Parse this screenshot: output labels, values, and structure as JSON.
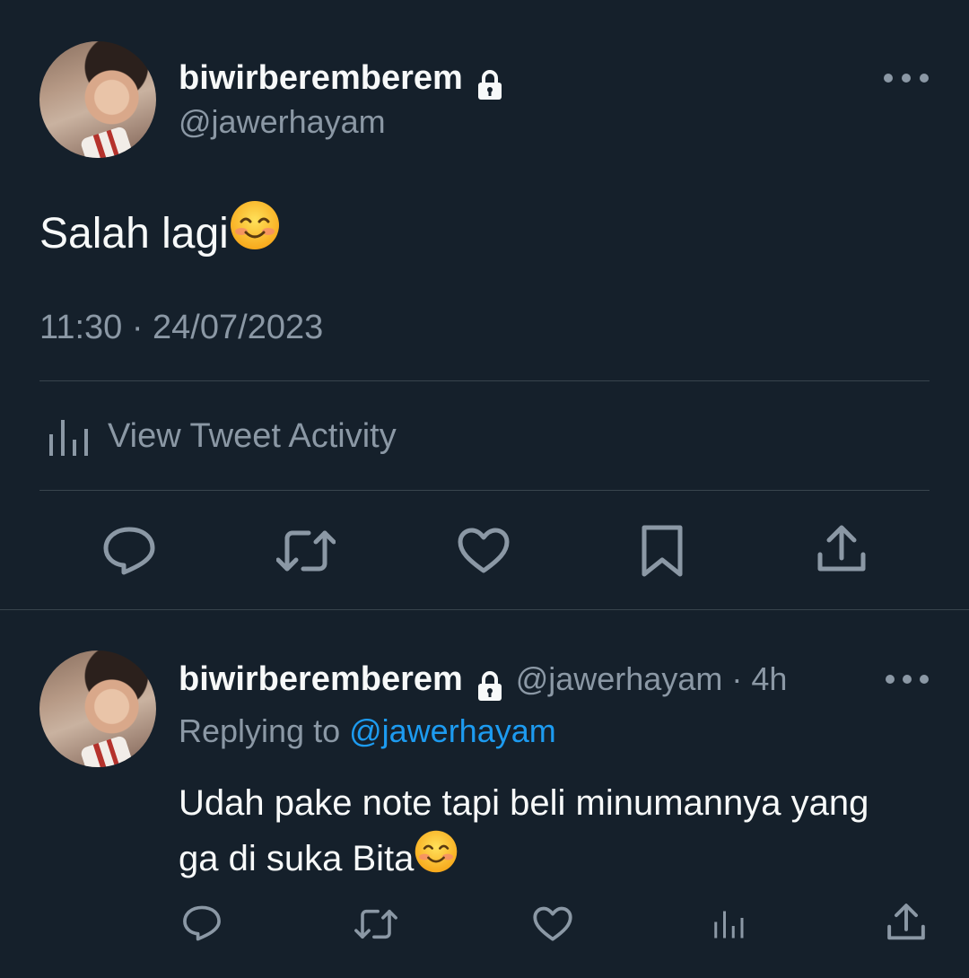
{
  "main_tweet": {
    "display_name": "biwirberemberem",
    "handle": "@jawerhayam",
    "text": "Salah lagi",
    "timestamp": "11:30 · 24/07/2023",
    "activity_label": "View Tweet Activity",
    "icons": [
      "lock-icon",
      "more-icon",
      "analytics-icon",
      "reply-icon",
      "retweet-icon",
      "like-icon",
      "bookmark-icon",
      "share-icon"
    ]
  },
  "reply_tweet": {
    "display_name": "biwirberemberem",
    "handle_time": "@jawerhayam · 4h",
    "replying_prefix": "Replying to ",
    "replying_handle": "@jawerhayam",
    "text_line1": "Udah pake note tapi beli minumannya yang",
    "text_line2": "ga di suka Bita",
    "icons": [
      "reply-icon",
      "retweet-icon",
      "like-icon",
      "analytics-icon",
      "share-icon"
    ]
  },
  "colors": {
    "background": "#15202b",
    "text": "#f7f9f9",
    "muted": "#8b98a5",
    "link": "#1d9bf0",
    "divider": "#38444d"
  }
}
